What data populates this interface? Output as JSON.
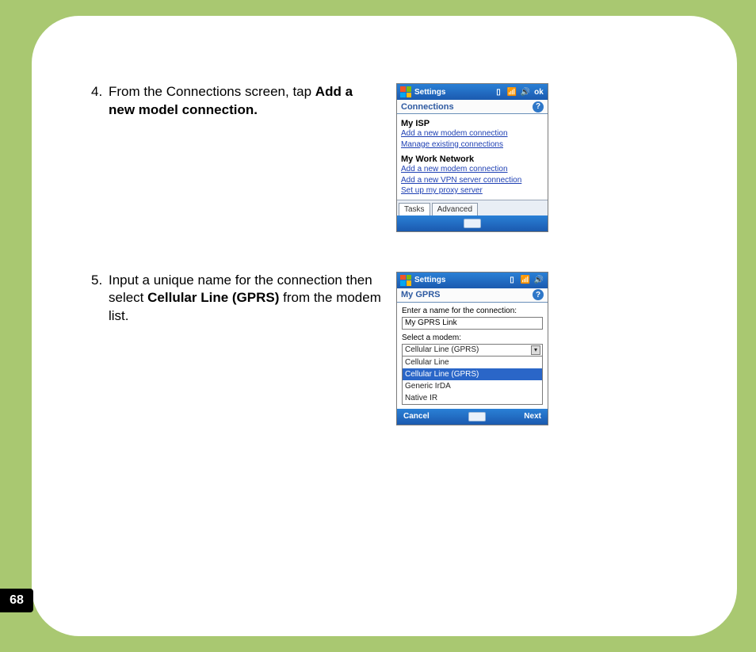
{
  "page_number": "68",
  "steps": [
    {
      "num": "4.",
      "text_pre": "From the Connections screen, tap ",
      "text_bold": "Add a new model connection.",
      "text_post": ""
    },
    {
      "num": "5.",
      "text_pre": "Input a unique name for the connection then select ",
      "text_bold": "Cellular Line (GPRS)",
      "text_post": " from the modem list."
    }
  ],
  "screen1": {
    "title": "Settings",
    "subtitle": "Connections",
    "isp_head": "My ISP",
    "isp_link1": "Add a new modem connection",
    "isp_link2": "Manage existing connections",
    "work_head": "My Work Network",
    "work_link1": "Add a new modem connection",
    "work_link2": "Add a new VPN server connection",
    "work_link3": "Set up my proxy server",
    "tab1": "Tasks",
    "tab2": "Advanced"
  },
  "screen2": {
    "title": "Settings",
    "subtitle": "My GPRS",
    "label_name": "Enter a name for the connection:",
    "input_value": "My GPRS Link",
    "label_modem": "Select a modem:",
    "combo_value": "Cellular Line (GPRS)",
    "options": {
      "o0": "Cellular Line",
      "o1": "Cellular Line (GPRS)",
      "o2": "Generic IrDA",
      "o3": "Native IR"
    },
    "btn_cancel": "Cancel",
    "btn_next": "Next"
  }
}
